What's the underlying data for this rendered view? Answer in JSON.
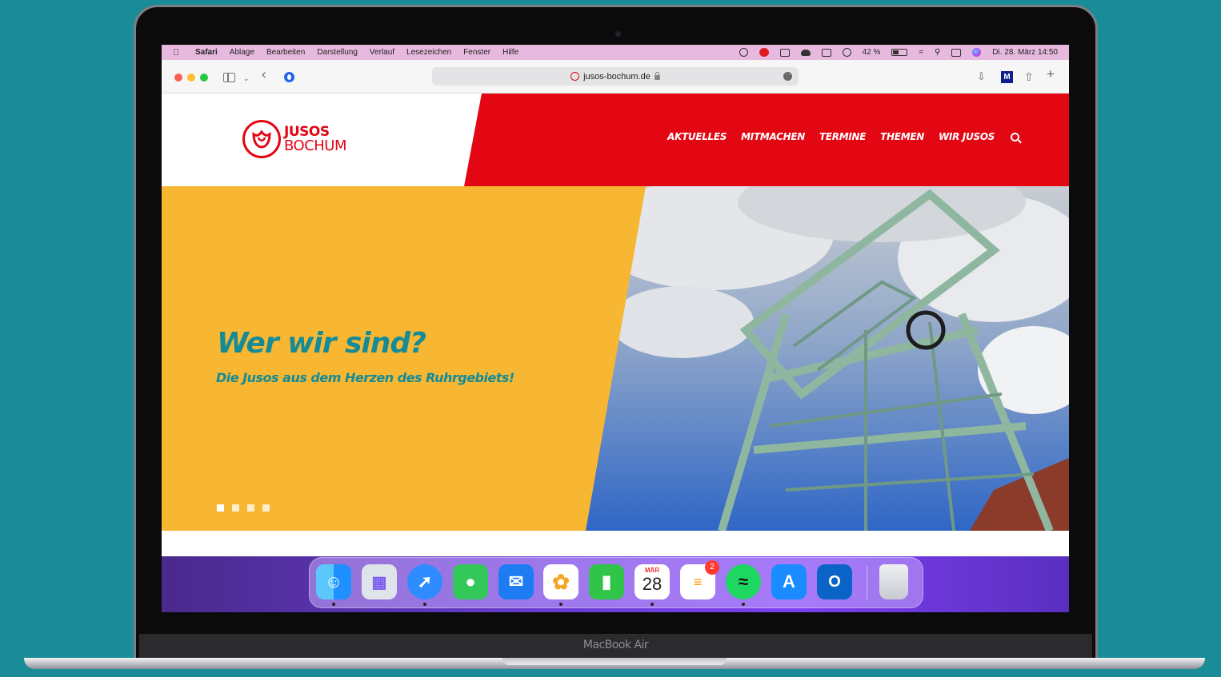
{
  "menubar": {
    "app": "Safari",
    "items": [
      "Ablage",
      "Bearbeiten",
      "Darstellung",
      "Verlauf",
      "Lesezeichen",
      "Fenster",
      "Hilfe"
    ],
    "battery": "42 %",
    "datetime": "Di. 28. März 14:50"
  },
  "browser": {
    "url": "jusos-bochum.de"
  },
  "site": {
    "logo_line1": "JUSOS",
    "logo_line2": "BOCHUM",
    "nav": [
      "AKTUELLES",
      "MITMACHEN",
      "TERMINE",
      "THEMEN",
      "WIR JUSOS"
    ],
    "hero_title": "Wer wir sind?",
    "hero_subtitle": "Die Jusos aus dem Herzen des Ruhrgebiets!",
    "slide_count": 4,
    "active_slide": 1
  },
  "dock": {
    "calendar_month": "MÄR",
    "calendar_day": "28",
    "reminders_badge": "2",
    "apps": [
      "finder",
      "launchpad",
      "safari",
      "messages",
      "mail",
      "photos",
      "facetime",
      "calendar",
      "reminders",
      "spotify",
      "app-store",
      "outlook",
      "trash"
    ]
  },
  "device_label": "MacBook Air",
  "colors": {
    "background": "#1a8c98",
    "brand_red": "#e30613",
    "hero_yellow": "#f7b733",
    "hero_text": "#148b96"
  }
}
